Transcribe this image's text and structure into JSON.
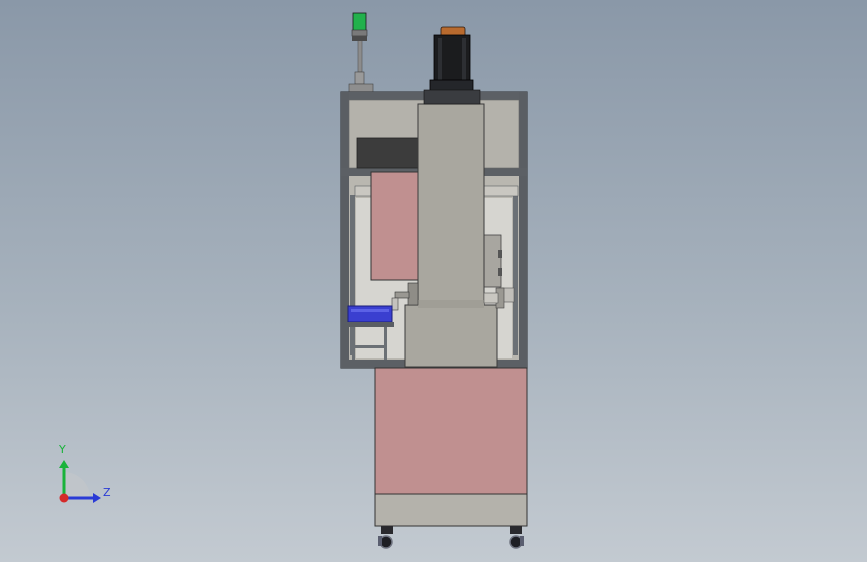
{
  "viewport": {
    "background_top": "#8a98a8",
    "background_bottom": "#c3cad1"
  },
  "model": {
    "colors": {
      "frame": "#4a4e52",
      "panel_gray": "#b4b2ab",
      "panel_pink": "#c09090",
      "column_gray": "#a9a79f",
      "motor_black": "#1b1c1e",
      "motor_cap": "#b86a2e",
      "tray_blue": "#3a3fd0",
      "light_green": "#22b14c",
      "dark_block": "#3c3c3c"
    }
  },
  "triad": {
    "y_label": "Y",
    "z_label": "Z",
    "y_color": "#19b33a",
    "z_color": "#2a3bd6",
    "x_color": "#d42a2a"
  }
}
